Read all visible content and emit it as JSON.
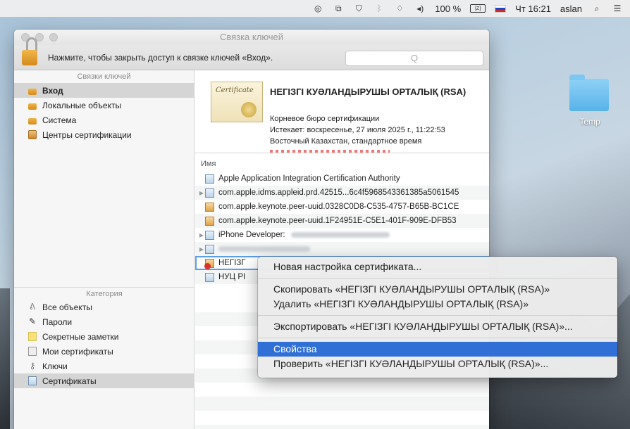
{
  "menubar": {
    "battery_percent": "100 %",
    "battery_label": "[Z]",
    "clock": "Чт 16:21",
    "user": "aslan"
  },
  "desktop": {
    "folder_label": "Temp"
  },
  "window": {
    "title": "Связка ключей",
    "lock_text": "Нажмите, чтобы закрыть доступ к связке ключей «Вход».",
    "search_placeholder": "Q"
  },
  "sidebar": {
    "keychains_header": "Связки ключей",
    "keychains": [
      {
        "label": "Вход",
        "selected": true
      },
      {
        "label": "Локальные объекты",
        "selected": false
      },
      {
        "label": "Система",
        "selected": false
      },
      {
        "label": "Центры сертификации",
        "selected": false
      }
    ],
    "category_header": "Категория",
    "categories": [
      {
        "label": "Все объекты",
        "selected": false
      },
      {
        "label": "Пароли",
        "selected": false
      },
      {
        "label": "Секретные заметки",
        "selected": false
      },
      {
        "label": "Мои сертификаты",
        "selected": false
      },
      {
        "label": "Ключи",
        "selected": false
      },
      {
        "label": "Сертификаты",
        "selected": true
      }
    ]
  },
  "certificate": {
    "image_text": "Certificate",
    "title": "НЕГІЗГІ КУӘЛАНДЫРУШЫ ОРТАЛЫҚ (RSA)",
    "subtitle": "Корневое бюро сертификации",
    "expires": "Истекает: воскресенье, 27 июля 2025 г., 11:22:53",
    "timezone": "Восточный Казахстан, стандартное время"
  },
  "list": {
    "column_name": "Имя",
    "rows": [
      {
        "label": "Apple Application Integration Certification Authority"
      },
      {
        "label": "com.apple.idms.appleid.prd.42515...6c4f5968543361385a5061545"
      },
      {
        "label": "com.apple.keynote.peer-uuid.0328C0D8-C535-4757-B65B-BC1CE"
      },
      {
        "label": "com.apple.keynote.peer-uuid.1F24951E-C5E1-401F-909E-DFB53"
      },
      {
        "label": "iPhone Developer:"
      },
      {
        "label": ""
      },
      {
        "label": "НЕГІЗГ"
      },
      {
        "label": "НУЦ РІ"
      }
    ]
  },
  "context_menu": {
    "new_preference": "Новая настройка сертификата...",
    "copy": "Скопировать «НЕГІЗГІ КУӘЛАНДЫРУШЫ ОРТАЛЫҚ (RSA)»",
    "delete": "Удалить «НЕГІЗГІ КУӘЛАНДЫРУШЫ ОРТАЛЫҚ (RSA)»",
    "export": "Экспортировать «НЕГІЗГІ КУӘЛАНДЫРУШЫ ОРТАЛЫҚ (RSA)»...",
    "properties": "Свойства",
    "verify": "Проверить «НЕГІЗГІ КУӘЛАНДЫРУШЫ ОРТАЛЫҚ (RSA)»..."
  },
  "colors": {
    "menu_highlight": "#2f6fd6",
    "sidebar_selected": "#d5d5d5",
    "focus_ring": "#5a9de8"
  }
}
